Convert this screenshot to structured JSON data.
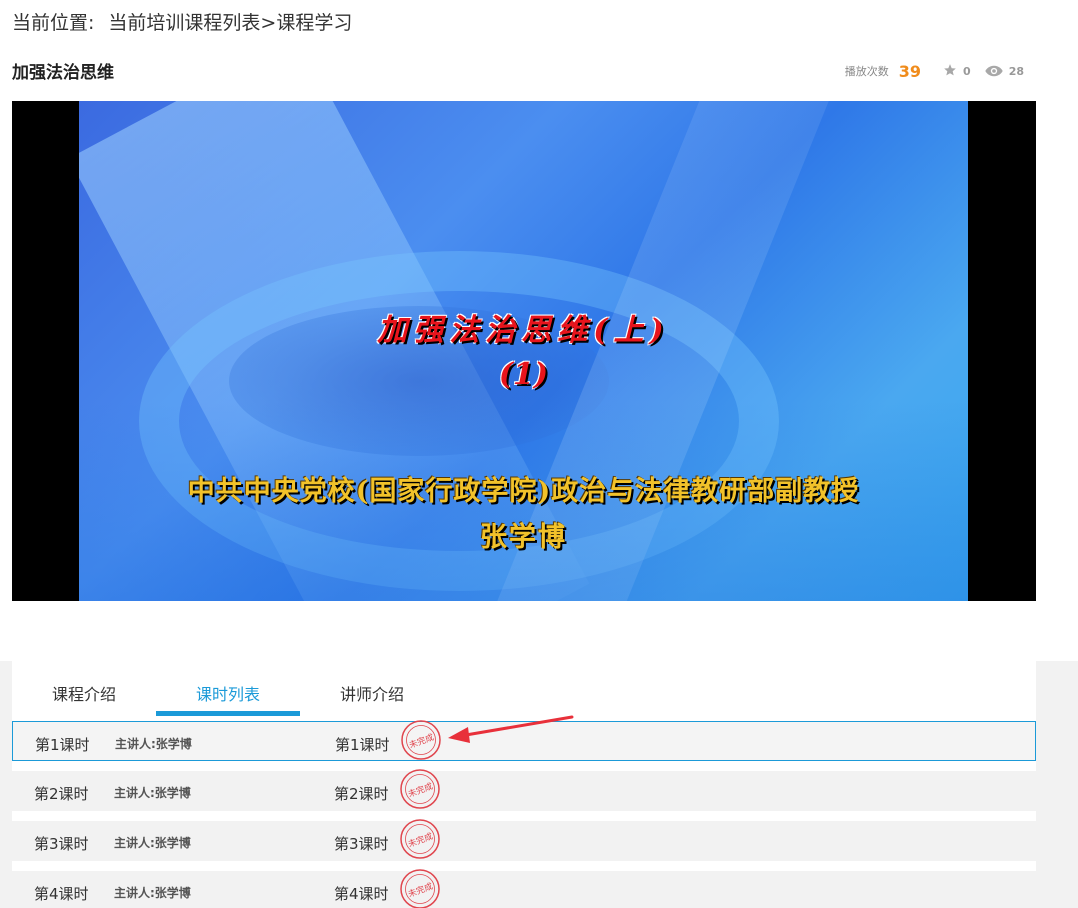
{
  "breadcrumb": {
    "label": "当前位置:",
    "path": "当前培训课程列表>课程学习"
  },
  "course": {
    "title": "加强法治思维",
    "play_label": "播放次数",
    "play_count": "39",
    "likes": "0",
    "views": "28"
  },
  "video": {
    "title": "加强法治思维(上)",
    "part": "(1)",
    "affiliation": "中共中央党校(国家行政学院)政治与法律教研部副教授",
    "lecturer": "张学博"
  },
  "tabs": [
    {
      "label": "课程介绍",
      "active": false
    },
    {
      "label": "课时列表",
      "active": true
    },
    {
      "label": "讲师介绍",
      "active": false
    }
  ],
  "lessons": [
    {
      "name": "第1课时",
      "lecturer": "主讲人:张学博",
      "name2": "第1课时",
      "stamp": "未完成"
    },
    {
      "name": "第2课时",
      "lecturer": "主讲人:张学博",
      "name2": "第2课时",
      "stamp": "未完成"
    },
    {
      "name": "第3课时",
      "lecturer": "主讲人:张学博",
      "name2": "第3课时",
      "stamp": "未完成"
    },
    {
      "name": "第4课时",
      "lecturer": "主讲人:张学博",
      "name2": "第4课时",
      "stamp": "未完成"
    }
  ],
  "colors": {
    "accent": "#1b9ad8",
    "play_count": "#f08c1c",
    "stamp": "#e0454d",
    "annotation_arrow": "#e8303a"
  },
  "icons": {
    "likes": "star-icon",
    "views": "eye-icon",
    "stamp": "incomplete-stamp-icon",
    "annotation": "red-arrow-icon"
  }
}
